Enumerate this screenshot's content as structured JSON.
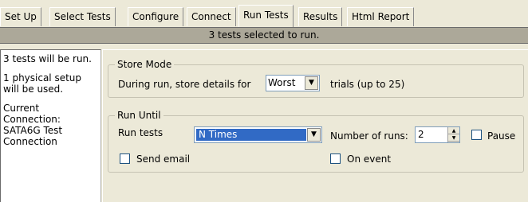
{
  "tabs": [
    {
      "label": "Set Up"
    },
    {
      "label": "Select Tests"
    },
    {
      "label": "Configure"
    },
    {
      "label": "Connect"
    },
    {
      "label": "Run Tests"
    },
    {
      "label": "Results"
    },
    {
      "label": "Html Report"
    }
  ],
  "active_tab": "Run Tests",
  "status": {
    "text": "3 tests selected to run."
  },
  "info": {
    "tests_count": "3 tests will be run.",
    "setup": "1 physical setup will be used.",
    "connection": "Current Connection: SATA6G Test Connection"
  },
  "store_mode": {
    "legend": "Store Mode",
    "prefix": "During run, store details for",
    "selected": "Worst",
    "suffix": "trials (up to 25)"
  },
  "run_until": {
    "legend": "Run Until",
    "run_tests_label": "Run tests",
    "run_tests_value": "N Times",
    "number_of_runs_label": "Number of runs:",
    "number_of_runs_value": "2",
    "pause_label": "Pause",
    "send_email_label": "Send email",
    "on_event_label": "On event"
  }
}
